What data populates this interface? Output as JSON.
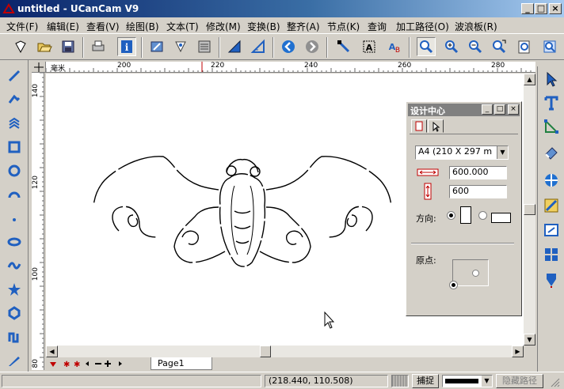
{
  "window": {
    "title": "untitled - UCanCam V9",
    "controls": [
      "minimize",
      "maximize",
      "close"
    ]
  },
  "menu": [
    "文件(F)",
    "编辑(E)",
    "查看(V)",
    "绘图(B)",
    "文本(T)",
    "修改(M)",
    "变换(B)",
    "整齐(A)",
    "节点(K)",
    "查询",
    "加工路径(O)",
    "波浪板(R)"
  ],
  "toolbar": {
    "icons": [
      "new-icon",
      "open-icon",
      "save-icon",
      "print-icon",
      "info-icon",
      "import-icon",
      "export-icon",
      "layers-icon",
      "ruler-icon",
      "measure-icon",
      "undo-icon",
      "redo-icon",
      "node-edit-icon",
      "align-icon",
      "text-align-icon",
      "zoom-in-icon",
      "zoom-plus-icon",
      "zoom-minus-icon",
      "zoom-area-icon",
      "zoom-page-icon",
      "zoom-all-icon"
    ]
  },
  "ruler": {
    "top_unit": "毫米",
    "top_ticks": [
      "200",
      "220",
      "240",
      "260",
      "280"
    ],
    "left_ticks": [
      "140",
      "120",
      "100",
      "80"
    ]
  },
  "pages": {
    "active_tab": "Page1"
  },
  "status": {
    "coordinates": "(218.440, 110.508)",
    "snap_label": "捕捉",
    "hide_path_label": "隐藏路径"
  },
  "design_center": {
    "title": "设计中心",
    "paper_size": "A4 (210 X 297 m",
    "width_value": "600.000",
    "height_value": "600",
    "orientation_label": "方向:",
    "orientation": "portrait",
    "origin_label": "原点:"
  },
  "colors": {
    "title_start": "#0a246a",
    "title_end": "#a6caf0",
    "panel_title": "#808080",
    "accent_blue": "#1f5fbf"
  }
}
